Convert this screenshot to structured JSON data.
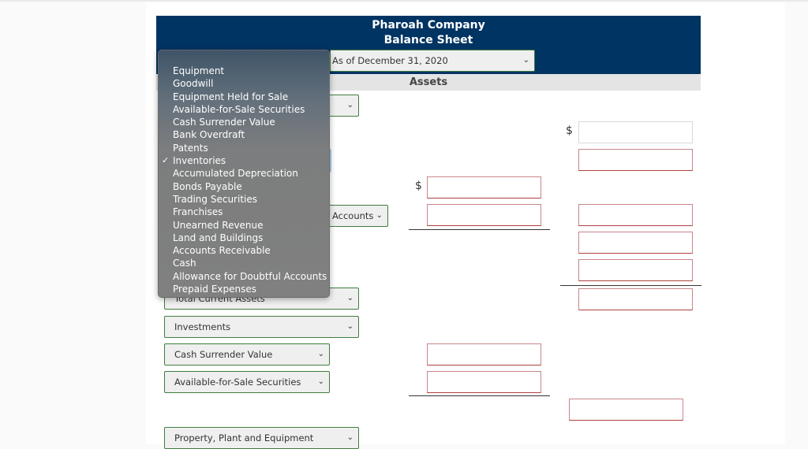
{
  "header": {
    "company": "Pharoah Company",
    "title": "Balance Sheet",
    "date_select": "As of December 31, 2020"
  },
  "section": {
    "assets_label": "Assets"
  },
  "currency_symbol": "$",
  "chevron": "⌄",
  "dropdown": {
    "checkmark": "✓",
    "selected": "Inventories",
    "options": [
      "Equipment",
      "Goodwill",
      "Equipment Held for Sale",
      "Available-for-Sale Securities",
      "Cash Surrender Value",
      "Bank Overdraft",
      "Patents",
      "Inventories",
      "Accumulated Depreciation",
      "Bonds Payable",
      "Trading Securities",
      "Franchises",
      "Unearned Revenue",
      "Land and Buildings",
      "Accounts Receivable",
      "Cash",
      "Allowance for Doubtful Accounts",
      "Prepaid Expenses"
    ]
  },
  "rows": {
    "allowance_partial": "Accounts",
    "total_current_assets": "Total Current Assets",
    "investments": "Investments",
    "cash_surrender_value": "Cash Surrender Value",
    "available_for_sale": "Available-for-Sale Securities",
    "ppe": "Property, Plant and Equipment"
  }
}
